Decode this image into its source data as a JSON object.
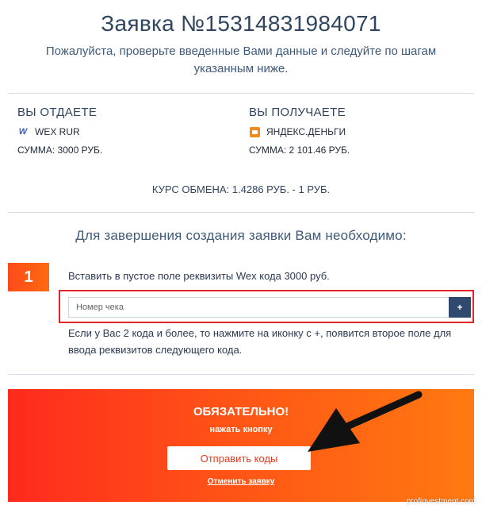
{
  "order": {
    "title": "Заявка №15314831984071",
    "subtitle": "Пожалуйста, проверьте введенные Вами данные и следуйте по шагам указанным ниже."
  },
  "give": {
    "heading": "ВЫ ОТДАЕТЕ",
    "currency": "WEX RUR",
    "icon": "wex-logo-icon",
    "sum": "СУММА: 3000 РУБ."
  },
  "receive": {
    "heading": "ВЫ ПОЛУЧАЕТЕ",
    "currency": "ЯНДЕКС.ДЕНЬГИ",
    "icon": "yandex-money-icon",
    "sum": "СУММА: 2 101.46 РУБ."
  },
  "rate": "КУРС ОБМЕНА: 1.4286 РУБ. - 1 РУБ.",
  "completion": {
    "heading": "Для завершения создания заявки Вам необходимо:",
    "step_number": "1",
    "step_text": "Вставить в пустое поле реквизиты Wex кода 3000 руб.",
    "input_placeholder": "Номер чека",
    "input_value": "",
    "add_label": "+",
    "hint": "Если у Вас 2 кода и более, то нажмите на иконку с +, появится второе поле для ввода реквизитов следующего кода."
  },
  "banner": {
    "title": "ОБЯЗАТЕЛЬНО!",
    "subtitle": "нажать кнопку",
    "send_label": "Отправить коды",
    "cancel_label": "Отменить заявку"
  },
  "watermark": "profinvestment.com",
  "colors": {
    "accent": "#ff4a1a",
    "highlight": "#e3262a",
    "primary_text": "#2f4560",
    "add_button": "#2f4a6e"
  }
}
